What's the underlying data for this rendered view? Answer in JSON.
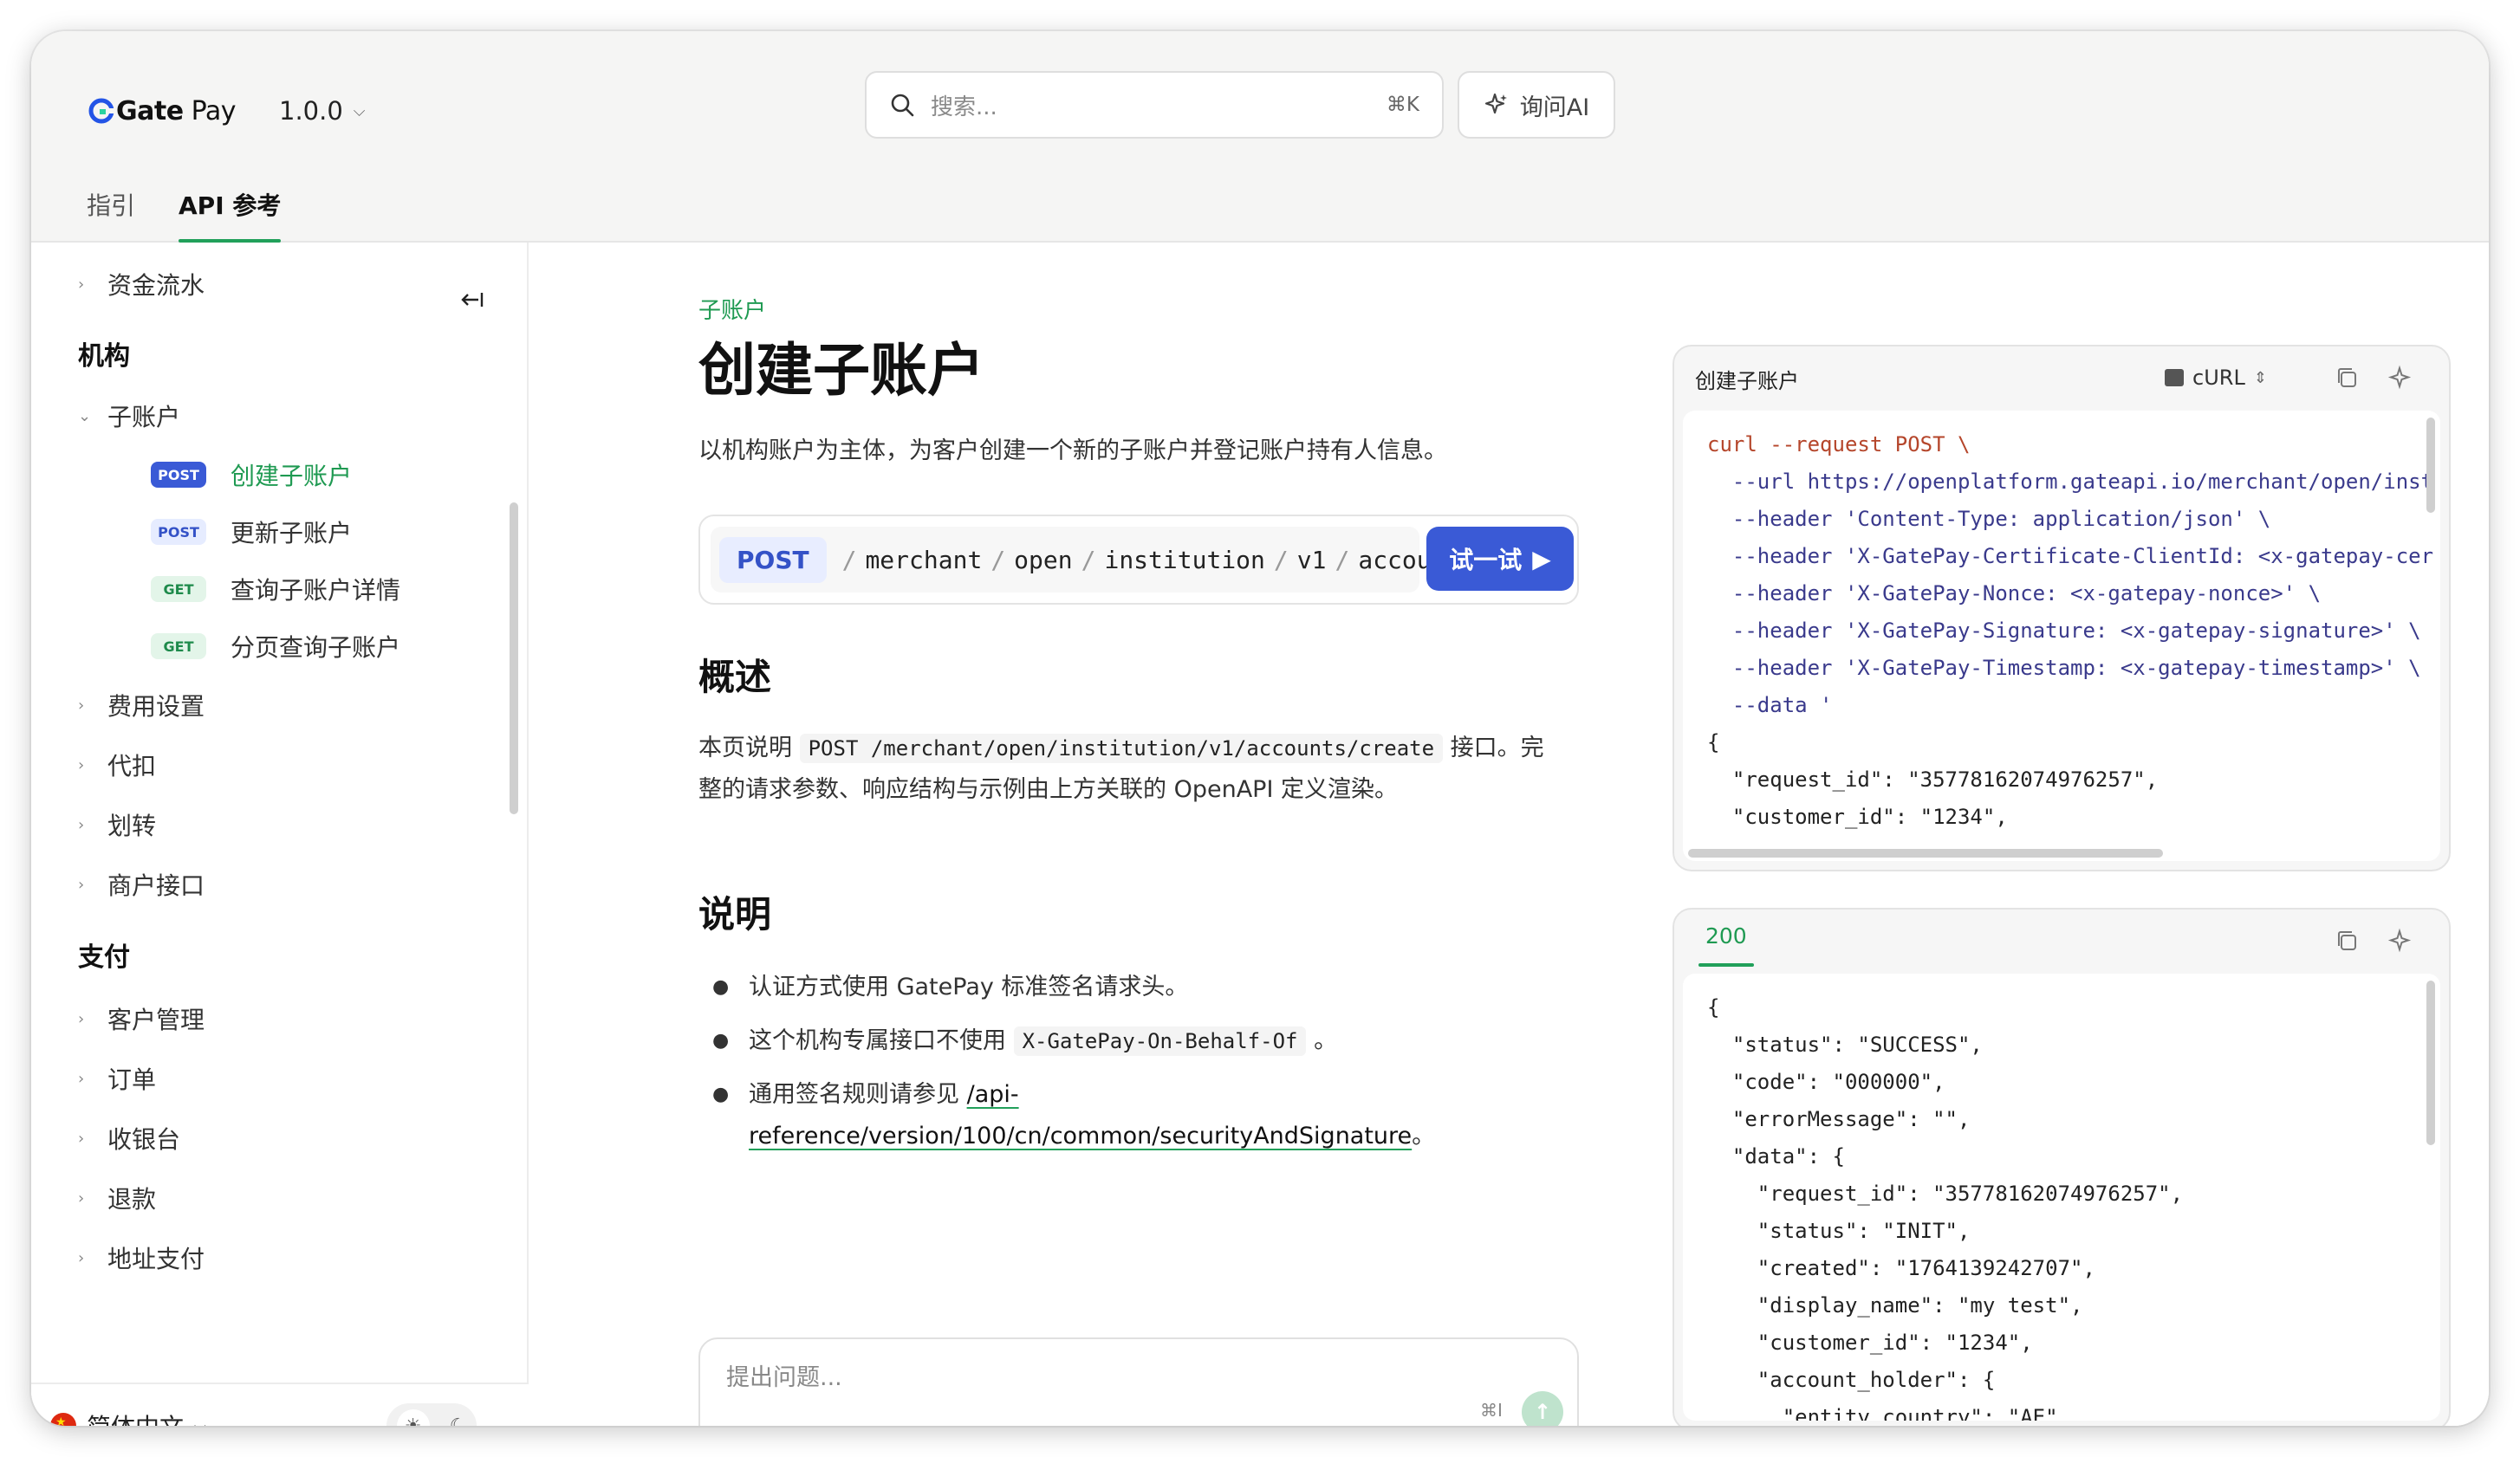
{
  "brand": {
    "name": "Gate",
    "suffix": " Pay",
    "accent": "#21a05a"
  },
  "version": {
    "label": "1.0.0"
  },
  "search": {
    "placeholder": "搜索...",
    "shortcut": "⌘K"
  },
  "ask_ai": {
    "label": "询问AI"
  },
  "tabs": [
    {
      "label": "指引"
    },
    {
      "label": "API 参考"
    }
  ],
  "sidebar": {
    "top_item": "资金流水",
    "sections": [
      {
        "title": "机构"
      },
      {
        "title": "支付"
      }
    ],
    "institution_items": [
      "子账户",
      "费用设置",
      "代扣",
      "划转",
      "商户接口"
    ],
    "sub_items": [
      {
        "method": "POST",
        "label": "创建子账户"
      },
      {
        "method": "POST",
        "label": "更新子账户"
      },
      {
        "method": "GET",
        "label": "查询子账户详情"
      },
      {
        "method": "GET",
        "label": "分页查询子账户"
      }
    ],
    "payment_items": [
      "客户管理",
      "订单",
      "收银台",
      "退款",
      "地址支付"
    ]
  },
  "footer": {
    "language": "简体中文"
  },
  "page": {
    "breadcrumb": "子账户",
    "title": "创建子账户",
    "description": "以机构账户为主体，为客户创建一个新的子账户并登记账户持有人信息。",
    "endpoint": {
      "method": "POST",
      "segments": [
        "merchant",
        "open",
        "institution",
        "v1",
        "accounts"
      ],
      "try_label": "试一试"
    },
    "overview": {
      "heading": "概述",
      "text_before": "本页说明",
      "code": "POST /merchant/open/institution/v1/accounts/create",
      "text_after": "接口。完",
      "line2": "整的请求参数、响应结构与示例由上方关联的 OpenAPI 定义渲染。"
    },
    "notes": {
      "heading": "说明",
      "b1": "认证方式使用 GatePay 标准签名请求头。",
      "b2_before": "这个机构专属接口不使用",
      "b2_code": "X-GatePay-On-Behalf-Of",
      "b2_after": "。",
      "b3_before": "通用签名规则请参见",
      "b3_link_1": "/api-",
      "b3_link_2": "reference/version/100/cn/common/securityAndSignature",
      "b3_after": "。"
    },
    "ask_box": {
      "placeholder": "提出问题...",
      "shortcut": "⌘I"
    }
  },
  "request_panel": {
    "title": "创建子账户",
    "language": "cURL",
    "lines": [
      "curl --request POST \\",
      "  --url https://openplatform.gateapi.io/merchant/open/inst",
      "  --header 'Content-Type: application/json' \\",
      "  --header 'X-GatePay-Certificate-ClientId: <x-gatepay-cer",
      "  --header 'X-GatePay-Nonce: <x-gatepay-nonce>' \\",
      "  --header 'X-GatePay-Signature: <x-gatepay-signature>' \\",
      "  --header 'X-GatePay-Timestamp: <x-gatepay-timestamp>' \\",
      "  --data '",
      "{",
      "  \"request_id\": \"35778162074976257\",",
      "  \"customer_id\": \"1234\","
    ]
  },
  "response_panel": {
    "status": "200",
    "lines": [
      "{",
      "  \"status\": \"SUCCESS\",",
      "  \"code\": \"000000\",",
      "  \"errorMessage\": \"\",",
      "  \"data\": {",
      "    \"request_id\": \"35778162074976257\",",
      "    \"status\": \"INIT\",",
      "    \"created\": \"1764139242707\",",
      "    \"display_name\": \"my test\",",
      "    \"customer_id\": \"1234\",",
      "    \"account_holder\": {",
      "      \"entity_country\": \"AE\","
    ]
  }
}
